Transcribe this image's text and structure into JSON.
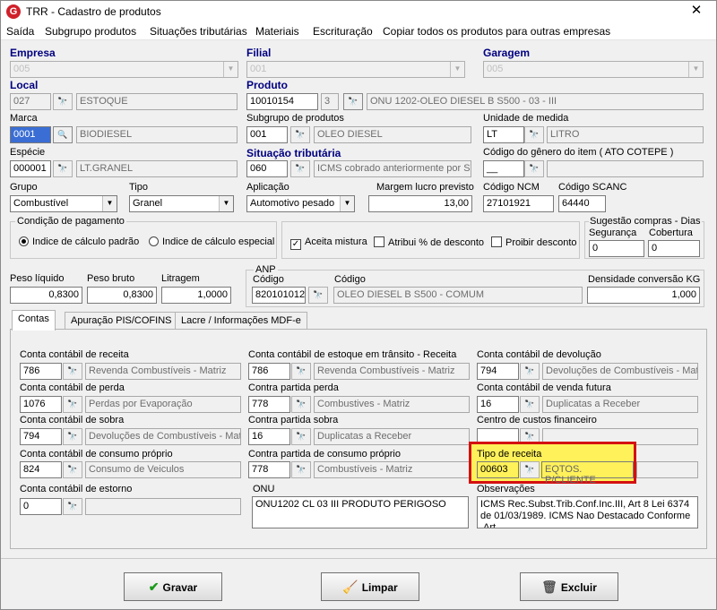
{
  "window": {
    "title": "TRR - Cadastro de produtos",
    "close": "✕"
  },
  "menu": [
    "Saída",
    "Subgrupo produtos",
    "Situações tributárias",
    "Materiais",
    "Escrituração",
    "Copiar todos os produtos para outras empresas"
  ],
  "labels": {
    "empresa": "Empresa",
    "filial": "Filial",
    "garagem": "Garagem",
    "local": "Local",
    "produto": "Produto",
    "marca": "Marca",
    "subgrupo": "Subgrupo de produtos",
    "unidade": "Unidade de medida",
    "especie": "Espécie",
    "situacao": "Situação tributária",
    "codigo_genero": "Código do gênero do item ( ATO COTEPE )",
    "grupo": "Grupo",
    "tipo": "Tipo",
    "aplicacao": "Aplicação",
    "margem": "Margem lucro previsto",
    "ncm": "Código NCM",
    "scanc": "Código SCANC",
    "condicao": "Condição de pagamento",
    "sugestao": "Sugestão compras - Dias",
    "seguranca": "Segurança",
    "cobertura": "Cobertura",
    "peso_liquido": "Peso líquido",
    "peso_bruto": "Peso bruto",
    "litragem": "Litragem",
    "anp": "ANP",
    "anp_codigo": "Código",
    "anp_codigo_desc": "Código",
    "densidade": "Densidade conversão KG"
  },
  "fields": {
    "empresa": "005",
    "filial": "001",
    "garagem": "005",
    "local_code": "027",
    "local_desc": "ESTOQUE",
    "produto_code": "10010154",
    "produto_seq": "3",
    "produto_desc": "ONU 1202-OLEO DIESEL B S500 - 03 - III",
    "marca_code": "0001",
    "marca_desc": "BIODIESEL",
    "subgrupo_code": "001",
    "subgrupo_desc": "OLEO DIESEL",
    "unidade_code": "LT",
    "unidade_desc": "LITRO",
    "especie_code": "000001",
    "especie_desc": "LT.GRANEL",
    "situacao_code": "060",
    "situacao_desc": "ICMS cobrado anteriormente por ST",
    "codigo_genero": "__",
    "grupo": "Combustível",
    "tipo": "Granel",
    "aplicacao": "Automotivo pesado",
    "margem": "13,00",
    "ncm": "27101921",
    "scanc": "64440",
    "seguranca": "0",
    "cobertura": "0",
    "peso_liquido": "0,8300",
    "peso_bruto": "0,8300",
    "litragem": "1,0000",
    "anp_code": "820101012",
    "anp_desc": "OLEO DIESEL B S500 - COMUM",
    "densidade": "1,000"
  },
  "options": {
    "radio_padrao": "Indice de cálculo padrão",
    "radio_especial": "Indice de cálculo especial",
    "aceita_mistura": "Aceita mistura",
    "atribui": "Atribui % de desconto",
    "proibir": "Proibir desconto"
  },
  "tabs": [
    "Contas",
    "Apuração PIS/COFINS",
    "Lacre / Informações MDF-e"
  ],
  "contas": {
    "receita": {
      "label": "Conta contábil de receita",
      "code": "786",
      "desc": "Revenda Combustíveis - Matriz"
    },
    "estoque_transito": {
      "label": "Conta contábil de estoque em trânsito - Receita",
      "code": "786",
      "desc": "Revenda Combustíveis - Matriz"
    },
    "devolucao": {
      "label": "Conta contábil de devolução",
      "code": "794",
      "desc": "Devoluções de Combustíveis - Matr"
    },
    "perda": {
      "label": "Conta contábil de perda",
      "code": "1076",
      "desc": "Perdas por Evaporação"
    },
    "partida_perda": {
      "label": "Contra partida  perda",
      "code": "778",
      "desc": "Combustives - Matriz"
    },
    "venda_futura": {
      "label": "Conta contábil de venda futura",
      "code": "16",
      "desc": "Duplicatas a Receber"
    },
    "sobra": {
      "label": "Conta contábil de sobra",
      "code": "794",
      "desc": "Devoluções de Combustíveis - Matr"
    },
    "partida_sobra": {
      "label": "Contra partida sobra",
      "code": "16",
      "desc": "Duplicatas a Receber"
    },
    "centro_custos": {
      "label": "Centro de custos financeiro",
      "code": "",
      "desc": ""
    },
    "consumo": {
      "label": "Conta contábil de consumo próprio",
      "code": "824",
      "desc": "Consumo de Veiculos"
    },
    "partida_consumo": {
      "label": "Contra partida de consumo próprio",
      "code": "778",
      "desc": "Combustíveis - Matriz"
    },
    "tipo_receita": {
      "label": "Tipo de receita",
      "code": "00603",
      "desc": "EQTOS. P/CLIENTE"
    },
    "estorno": {
      "label": "Conta contábil de estorno",
      "code": "0",
      "desc": ""
    },
    "onu": {
      "label": "ONU",
      "text": "ONU1202 CL 03 III PRODUTO PERIGOSO"
    },
    "observacoes": {
      "label": "Observações",
      "text": "ICMS Rec.Subst.Trib.Conf.Inc.III, Art 8 Lei 6374 de 01/03/1989. ICMS Nao Destacado Conforme .Art"
    }
  },
  "buttons": {
    "gravar": "Gravar",
    "limpar": "Limpar",
    "excluir": "Excluir"
  }
}
